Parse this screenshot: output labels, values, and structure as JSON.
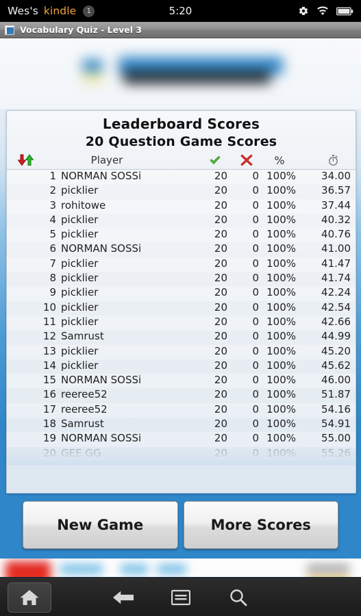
{
  "statusbar": {
    "owner": "Wes's",
    "brand": "kindle",
    "badge": "1",
    "clock": "5:20",
    "icons": [
      "gear-icon",
      "wifi-icon",
      "battery-icon"
    ]
  },
  "titlebar": {
    "title": "Vocabulary Quiz - Level 3",
    "icon": "app-icon"
  },
  "leaderboard": {
    "title": "Leaderboard Scores",
    "subtitle": "20 Question Game Scores",
    "columns": {
      "sort": "sort-arrows-icon",
      "player": "Player",
      "correct": "green-check-icon",
      "wrong": "red-cross-icon",
      "percent": "%",
      "time": "stopwatch-icon"
    },
    "rows": [
      {
        "rank": "1",
        "name": "NORMAN SOSSi",
        "correct": "20",
        "wrong": "0",
        "percent": "100%",
        "time": "34.00"
      },
      {
        "rank": "2",
        "name": "picklier",
        "correct": "20",
        "wrong": "0",
        "percent": "100%",
        "time": "36.57"
      },
      {
        "rank": "3",
        "name": "rohitowe",
        "correct": "20",
        "wrong": "0",
        "percent": "100%",
        "time": "37.44"
      },
      {
        "rank": "4",
        "name": "picklier",
        "correct": "20",
        "wrong": "0",
        "percent": "100%",
        "time": "40.32"
      },
      {
        "rank": "5",
        "name": "picklier",
        "correct": "20",
        "wrong": "0",
        "percent": "100%",
        "time": "40.76"
      },
      {
        "rank": "6",
        "name": "NORMAN SOSSi",
        "correct": "20",
        "wrong": "0",
        "percent": "100%",
        "time": "41.00"
      },
      {
        "rank": "7",
        "name": "picklier",
        "correct": "20",
        "wrong": "0",
        "percent": "100%",
        "time": "41.47"
      },
      {
        "rank": "8",
        "name": "picklier",
        "correct": "20",
        "wrong": "0",
        "percent": "100%",
        "time": "41.74"
      },
      {
        "rank": "9",
        "name": "picklier",
        "correct": "20",
        "wrong": "0",
        "percent": "100%",
        "time": "42.24"
      },
      {
        "rank": "10",
        "name": "picklier",
        "correct": "20",
        "wrong": "0",
        "percent": "100%",
        "time": "42.54"
      },
      {
        "rank": "11",
        "name": "picklier",
        "correct": "20",
        "wrong": "0",
        "percent": "100%",
        "time": "42.66"
      },
      {
        "rank": "12",
        "name": "Samrust",
        "correct": "20",
        "wrong": "0",
        "percent": "100%",
        "time": "44.99"
      },
      {
        "rank": "13",
        "name": "picklier",
        "correct": "20",
        "wrong": "0",
        "percent": "100%",
        "time": "45.20"
      },
      {
        "rank": "14",
        "name": "picklier",
        "correct": "20",
        "wrong": "0",
        "percent": "100%",
        "time": "45.62"
      },
      {
        "rank": "15",
        "name": "NORMAN SOSSi",
        "correct": "20",
        "wrong": "0",
        "percent": "100%",
        "time": "46.00"
      },
      {
        "rank": "16",
        "name": "reeree52",
        "correct": "20",
        "wrong": "0",
        "percent": "100%",
        "time": "51.87"
      },
      {
        "rank": "17",
        "name": "reeree52",
        "correct": "20",
        "wrong": "0",
        "percent": "100%",
        "time": "54.16"
      },
      {
        "rank": "18",
        "name": "Samrust",
        "correct": "20",
        "wrong": "0",
        "percent": "100%",
        "time": "54.91"
      },
      {
        "rank": "19",
        "name": "NORMAN SOSSi",
        "correct": "20",
        "wrong": "0",
        "percent": "100%",
        "time": "55.00"
      },
      {
        "rank": "20",
        "name": "GEE GG",
        "correct": "20",
        "wrong": "0",
        "percent": "100%",
        "time": "55.26"
      }
    ]
  },
  "buttons": {
    "new_game": "New Game",
    "more_scores": "More Scores"
  },
  "navbar": {
    "home": "home-icon",
    "back": "back-arrow-icon",
    "menu": "menu-icon",
    "search": "search-icon"
  },
  "colors": {
    "accent_blue": "#2f86c8",
    "brand_orange": "#f0a23c",
    "check_green": "#55b73e",
    "cross_red": "#d93025",
    "panel_bg": "#eef2f6"
  }
}
